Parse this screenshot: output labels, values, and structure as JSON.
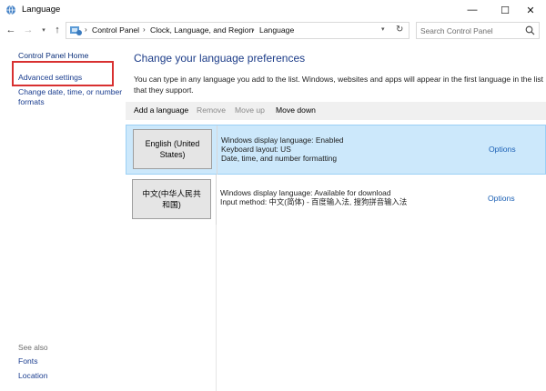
{
  "window": {
    "title": "Language",
    "minimize_glyph": "—",
    "maximize_glyph": "☐",
    "close_glyph": "✕"
  },
  "nav": {
    "back_glyph": "←",
    "forward_glyph": "→",
    "dropdown_glyph": "▾",
    "up_glyph": "↑"
  },
  "address": {
    "crumbs": [
      "Control Panel",
      "Clock, Language, and Region",
      "Language"
    ],
    "separator": "›",
    "dropdown_glyph": "▾",
    "refresh_glyph": "↻"
  },
  "search": {
    "placeholder": "Search Control Panel"
  },
  "sidebar": {
    "home": "Control Panel Home",
    "links": [
      "Advanced settings",
      "Change date, time, or number formats"
    ],
    "see_also_label": "See also",
    "see_also_links": [
      "Fonts",
      "Location"
    ]
  },
  "main": {
    "title": "Change your language preferences",
    "description": "You can type in any language you add to the list. Windows, websites and apps will appear in the first language in the list that they support.",
    "toolbar": {
      "add": "Add a language",
      "remove": "Remove",
      "move_up": "Move up",
      "move_down": "Move down"
    },
    "languages": [
      {
        "name": "English (United States)",
        "lines": [
          "Windows display language: Enabled",
          "Keyboard layout: US",
          "Date, time, and number formatting"
        ],
        "options": "Options"
      },
      {
        "name": "中文(中华人民共和国)",
        "lines": [
          "Windows display language: Available for download",
          "Input method: 中文(简体) - 百度输入法, 搜狗拼音输入法"
        ],
        "options": "Options"
      }
    ]
  },
  "colors": {
    "link": "#1a3d8f",
    "title": "#1c3c88",
    "selection": "#cce8fb",
    "highlight_box": "#d83030"
  }
}
